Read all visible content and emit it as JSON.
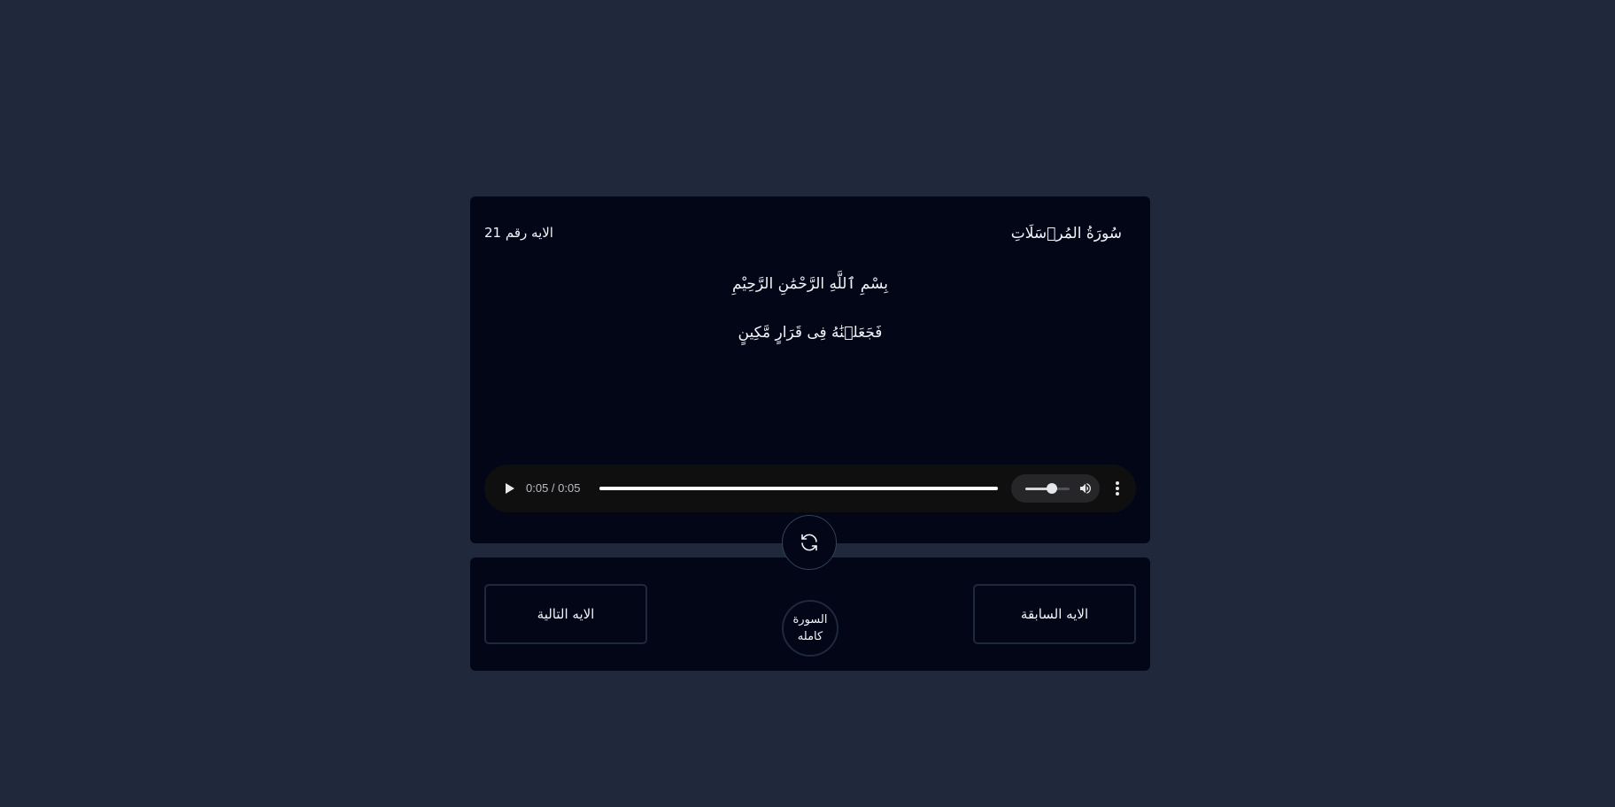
{
  "header": {
    "surah_name": "سُورَةُ المُرۡسَلَاتِ",
    "ayah_number": "الايه رقم 21"
  },
  "content": {
    "basmala": "بِسْمِ ٱللَّهِ الرَّحْمَٰنِ الرَّحِيْمِ",
    "ayah_text": "فَجَعَلۡنَٰهُ فِى قَرَارٍ مَّكِينٍ"
  },
  "audio_player": {
    "time_display": "0:05 / 0:05",
    "progress": 1.0,
    "volume": 0.6,
    "play_icon": "play-icon",
    "volume_icon": "speaker-icon",
    "menu_icon": "more-vertical-icon"
  },
  "controls": {
    "refresh_icon": "refresh-icon",
    "next_label": "الايه التالية",
    "previous_label": "الايه السابقة",
    "full_surah_label": "السورة كامله"
  },
  "colors": {
    "page_background": "#1f293b",
    "card_background": "#020617",
    "border": "#1e293b",
    "text": "#f1f5f9"
  }
}
